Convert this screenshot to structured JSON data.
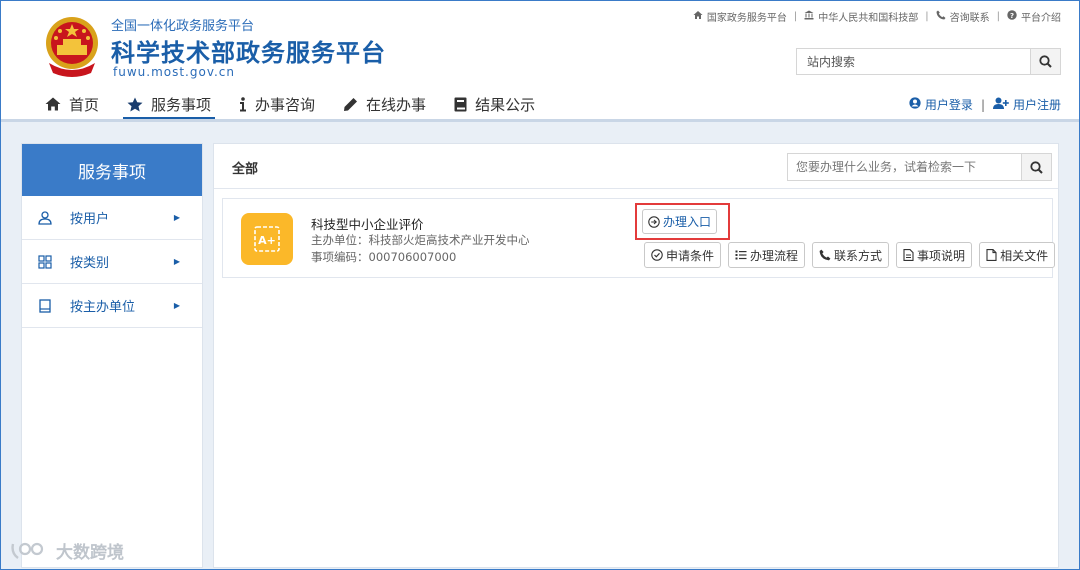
{
  "header": {
    "subtitle": "全国一体化政务服务平台",
    "title": "科学技术部政务服务平台",
    "url": "fuwu.most.gov.cn"
  },
  "toplinks": [
    {
      "label": "国家政务服务平台",
      "icon": "home-icon"
    },
    {
      "label": "中华人民共和国科技部",
      "icon": "institution-icon"
    },
    {
      "label": "咨询联系",
      "icon": "phone-icon"
    },
    {
      "label": "平台介绍",
      "icon": "question-icon"
    }
  ],
  "site_search": {
    "placeholder": "站内搜索"
  },
  "nav": [
    {
      "label": "首页",
      "icon": "home-icon"
    },
    {
      "label": "服务事项",
      "icon": "star-icon",
      "active": true
    },
    {
      "label": "办事咨询",
      "icon": "info-icon"
    },
    {
      "label": "在线办事",
      "icon": "pencil-icon"
    },
    {
      "label": "结果公示",
      "icon": "book-icon"
    }
  ],
  "user": {
    "login": "用户登录",
    "register": "用户注册"
  },
  "sidebar": {
    "title": "服务事项",
    "items": [
      {
        "label": "按用户",
        "icon": "user-icon"
      },
      {
        "label": "按类别",
        "icon": "grid-icon"
      },
      {
        "label": "按主办单位",
        "icon": "building-icon"
      }
    ]
  },
  "main": {
    "title": "全部",
    "search_placeholder": "您要办理什么业务，试着检索一下"
  },
  "service": {
    "name": "科技型中小企业评价",
    "org": "主办单位：科技部火炬高技术产业开发中心",
    "code": "事项编码：000706007000",
    "enter_label": "办理入口",
    "icon_text": "A+",
    "actions": [
      {
        "label": "申请条件",
        "icon": "check-circle-icon"
      },
      {
        "label": "办理流程",
        "icon": "list-icon"
      },
      {
        "label": "联系方式",
        "icon": "phone-icon"
      },
      {
        "label": "事项说明",
        "icon": "document-icon"
      },
      {
        "label": "相关文件",
        "icon": "file-icon"
      }
    ]
  },
  "watermark": "大数跨境",
  "colors": {
    "primary": "#1a5ea8",
    "sidebar_header": "#3a7bc8",
    "service_icon_bg": "#fbb829",
    "highlight": "#e33b3b",
    "content_bg": "#e9eff6"
  }
}
